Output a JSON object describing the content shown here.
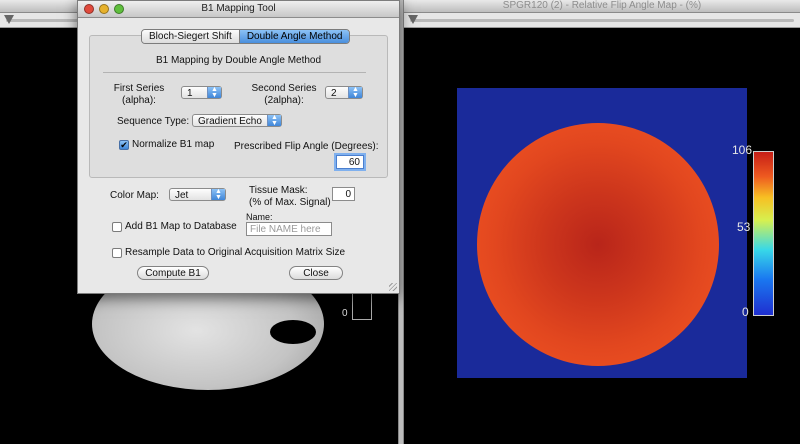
{
  "left_viewer": {
    "colorbar_min_label": "0"
  },
  "right_viewer": {
    "title": "SPGR120 (2) - Relative Flip Angle Map - (%)",
    "colorbar": {
      "max_label": "106",
      "mid_label": "53",
      "min_label": "0"
    }
  },
  "dialog": {
    "title": "B1 Mapping Tool",
    "tabs": [
      {
        "label": "Bloch-Siegert Shift",
        "selected": false
      },
      {
        "label": "Double Angle Method",
        "selected": true
      }
    ],
    "heading": "B1 Mapping by Double Angle Method",
    "first_series": {
      "label_line1": "First Series",
      "label_line2": "(alpha):",
      "value": "1"
    },
    "second_series": {
      "label_line1": "Second Series",
      "label_line2": "(2alpha):",
      "value": "2"
    },
    "sequence_type": {
      "label": "Sequence Type:",
      "value": "Gradient Echo"
    },
    "normalize": {
      "label": "Normalize B1 map",
      "checked": true,
      "check_glyph": "✔"
    },
    "flip_angle": {
      "label": "Prescribed Flip Angle (Degrees):",
      "value": "60"
    },
    "color_map": {
      "label": "Color Map:",
      "value": "Jet"
    },
    "tissue_mask": {
      "label_line1": "Tissue Mask:",
      "label_line2": "(% of Max. Signal)",
      "value": "0"
    },
    "add_to_db": {
      "label": "Add B1 Map to Database",
      "checked": false
    },
    "name_field": {
      "label": "Name:",
      "placeholder": "File NAME here"
    },
    "resample": {
      "label": "Resample Data to Original Acquisition Matrix Size",
      "checked": false
    },
    "compute_button": "Compute B1",
    "close_button": "Close"
  }
}
